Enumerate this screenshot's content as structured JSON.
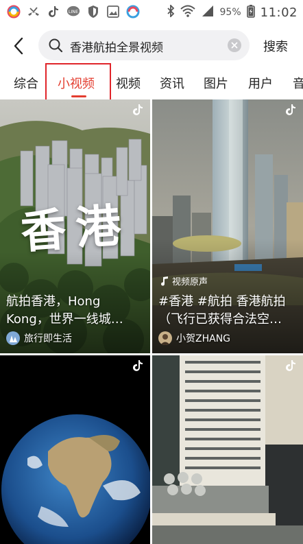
{
  "status_bar": {
    "time": "11:02",
    "battery_percent": "95%",
    "icons": [
      "sync-icon",
      "missed-call-icon",
      "tiktok-icon",
      "line-app-icon",
      "shield-icon",
      "gallery-icon",
      "sync-icon",
      "bluetooth-icon",
      "wifi-icon",
      "signal-icon",
      "battery-icon"
    ]
  },
  "search": {
    "query": "香港航拍全景视频",
    "submit_label": "搜索"
  },
  "tabs": [
    {
      "label": "综合",
      "active": false
    },
    {
      "label": "小视频",
      "active": true
    },
    {
      "label": "视频",
      "active": false
    },
    {
      "label": "资讯",
      "active": false
    },
    {
      "label": "图片",
      "active": false
    },
    {
      "label": "用户",
      "active": false
    },
    {
      "label": "音",
      "active": false
    }
  ],
  "cards": [
    {
      "overlay_text": "香港",
      "caption_line1": "航拍香港，Hong",
      "caption_line2": "Kong，世界一线城…",
      "author": "旅行即生活"
    },
    {
      "music_tag": "视频原声",
      "caption_line1": "#香港 #航拍 香港航拍",
      "caption_line2": "（飞行已获得合法空…",
      "author": "小贺ZHANG"
    },
    {},
    {}
  ],
  "colors": {
    "accent": "#e33d2f",
    "highlight_box": "#e0242a",
    "search_bg": "#f1f1f3"
  }
}
